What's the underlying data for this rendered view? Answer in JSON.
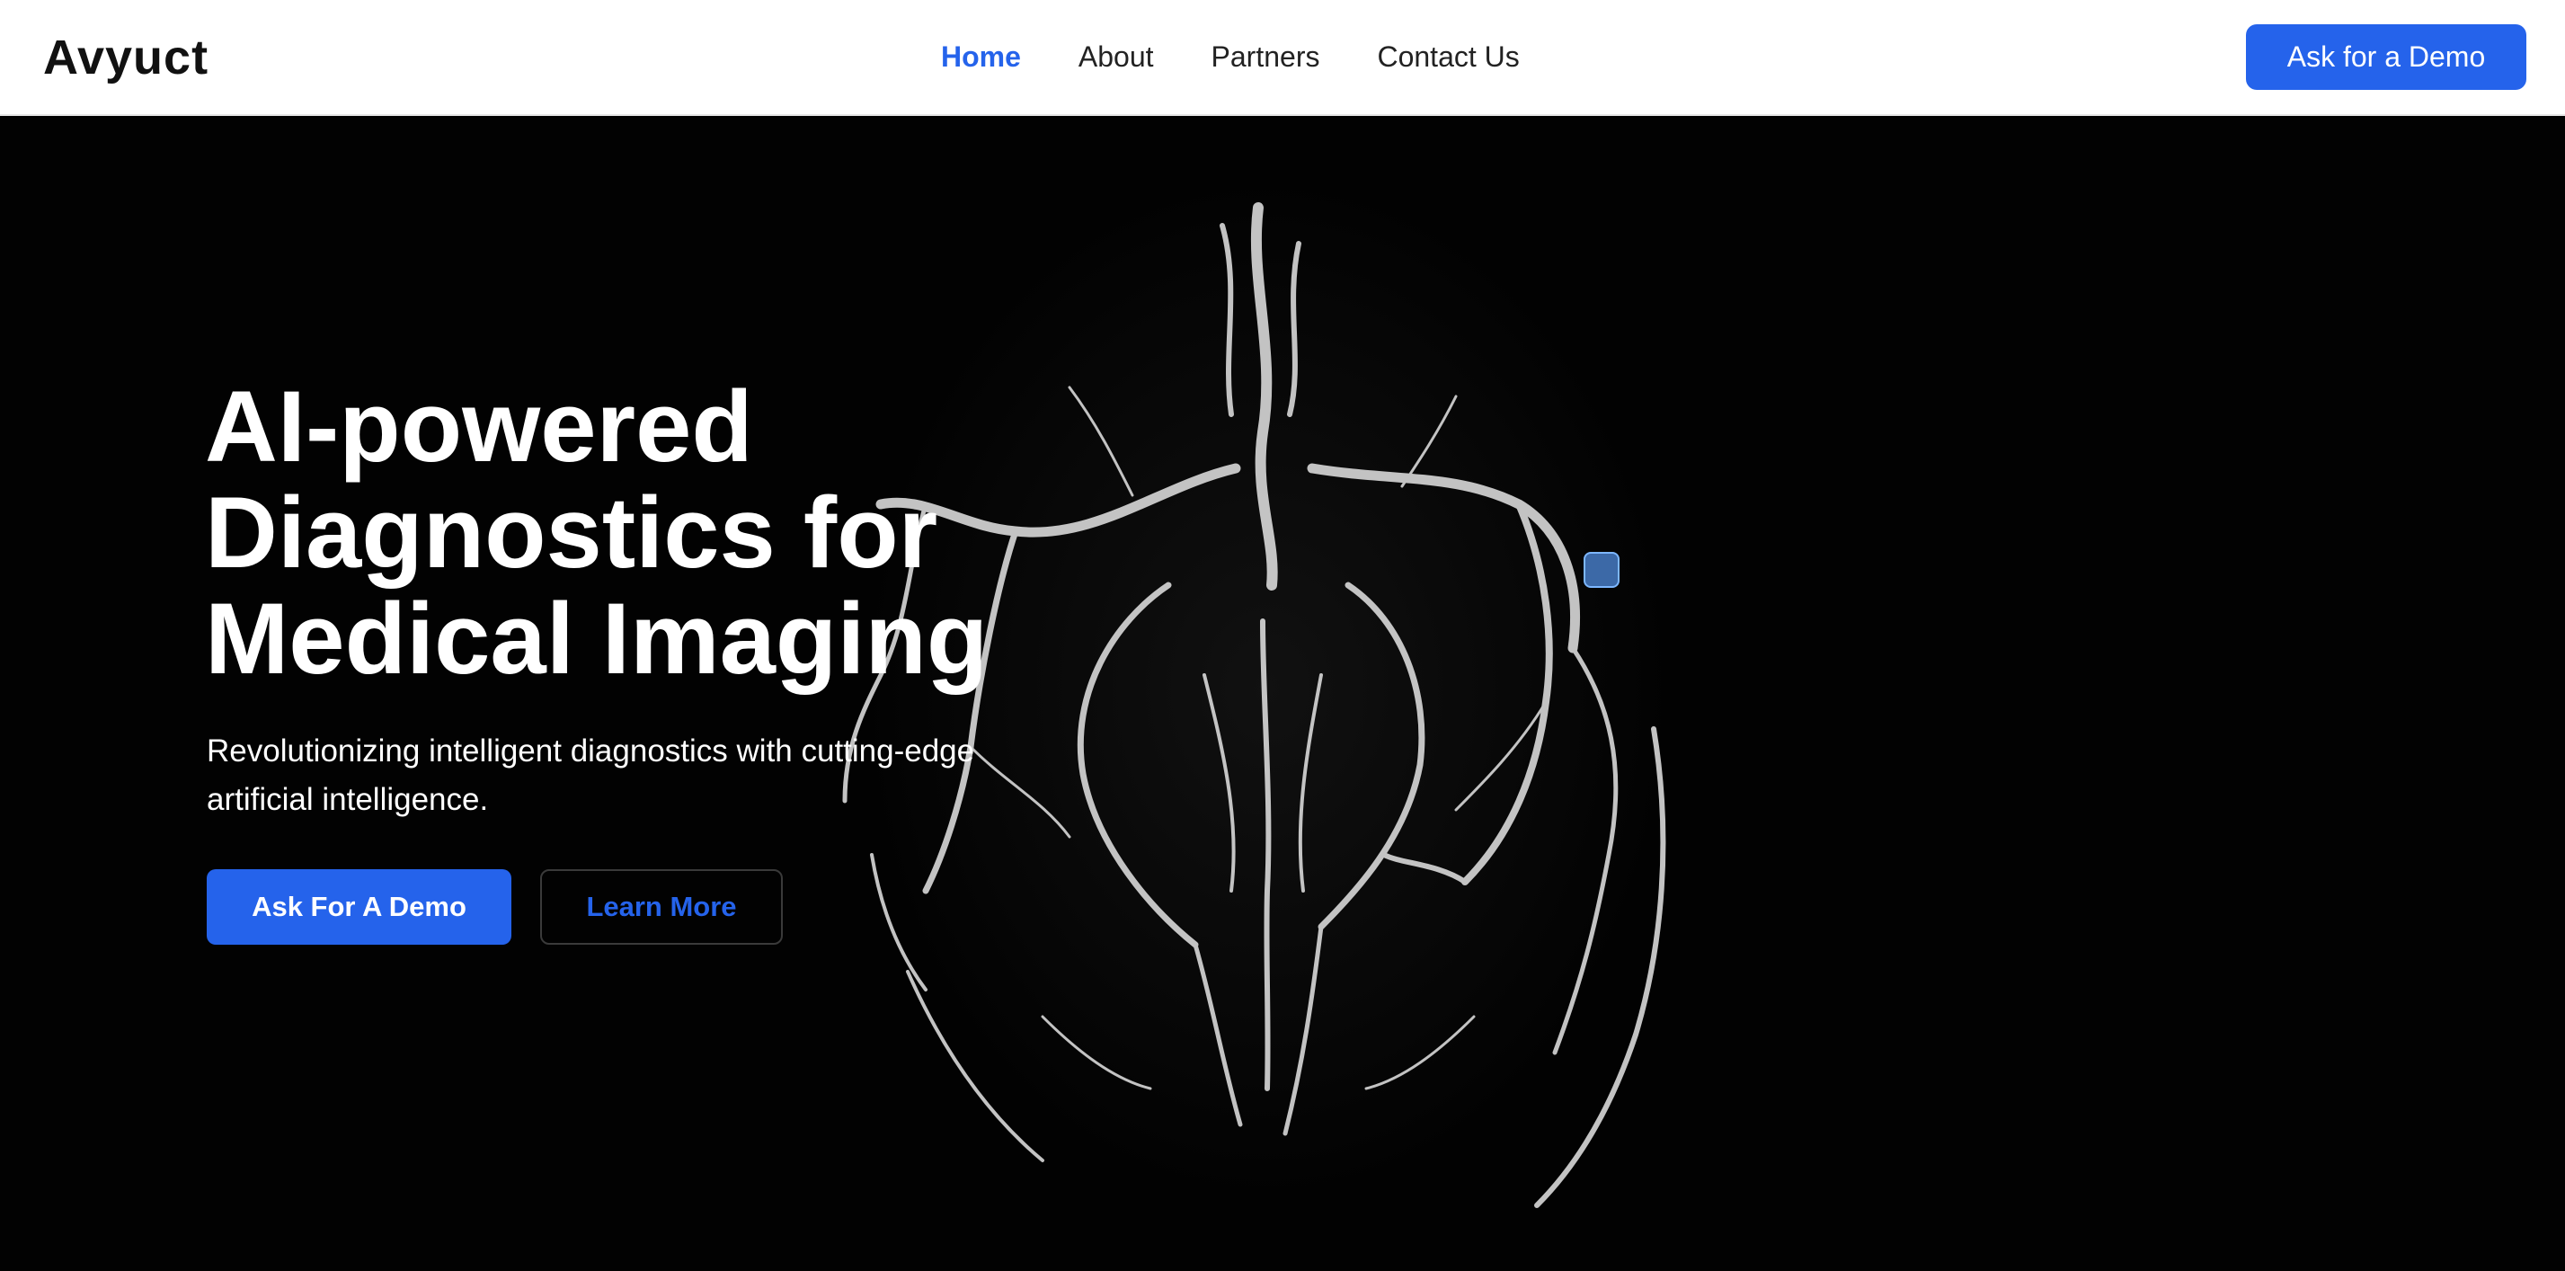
{
  "brand": {
    "name": "Avyuct"
  },
  "nav": {
    "items": [
      {
        "label": "Home",
        "active": true
      },
      {
        "label": "About",
        "active": false
      },
      {
        "label": "Partners",
        "active": false
      },
      {
        "label": "Contact Us",
        "active": false
      }
    ],
    "demo_button": "Ask for a Demo"
  },
  "hero": {
    "title_line1": "AI-powered",
    "title_line2": "Diagnostics for",
    "title_line3": "Medical Imaging",
    "subtitle": "Revolutionizing intelligent diagnostics with cutting-edge artificial intelligence.",
    "primary_button": "Ask For A Demo",
    "secondary_button": "Learn More",
    "background_image": "brain-angiography-image"
  },
  "colors": {
    "accent": "#2563eb",
    "hero_background": "#020202",
    "navbar_background": "#ffffff"
  }
}
